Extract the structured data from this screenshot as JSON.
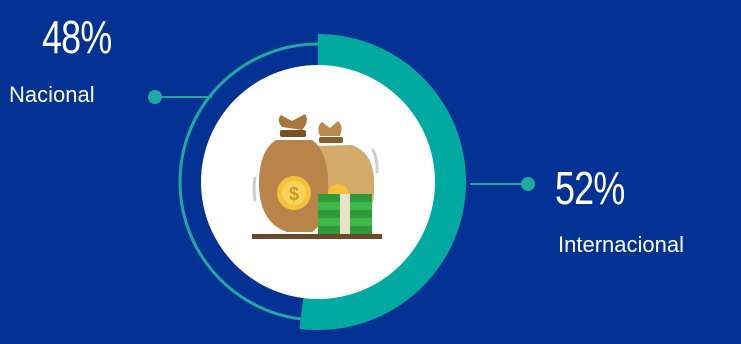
{
  "chart_data": {
    "type": "pie",
    "categories": [
      "Nacional",
      "Internacional"
    ],
    "values": [
      48,
      52
    ],
    "value_labels": [
      "48%",
      "52%"
    ],
    "colors": {
      "nacional": "#1fa9a2",
      "internacional": "#00aaa0"
    }
  },
  "theme": {
    "background": "#033194",
    "inner_circle": "#ffffff",
    "text": "#ffffff"
  },
  "icon": "money-bags-with-cash-icon"
}
